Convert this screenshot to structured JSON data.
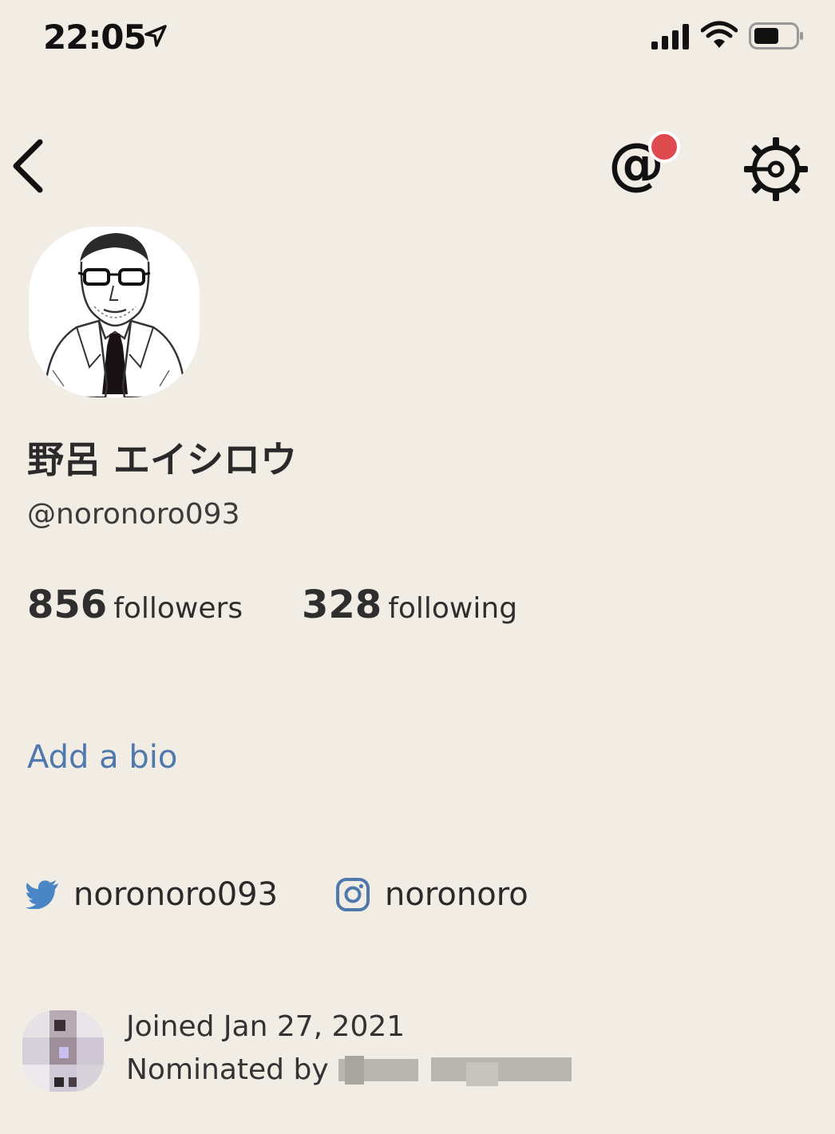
{
  "status_bar": {
    "time": "22:05"
  },
  "nav": {
    "mention_glyph": "@"
  },
  "profile": {
    "display_name": "野呂 エイシロウ",
    "handle": "@noronoro093",
    "followers_count": "856",
    "followers_label": "followers",
    "following_count": "328",
    "following_label": "following",
    "bio_link": "Add a bio"
  },
  "social": {
    "twitter_handle": "noronoro093",
    "instagram_handle": "noronoro"
  },
  "footer": {
    "joined": "Joined Jan 27, 2021",
    "nominated_by": "Nominated by"
  },
  "colors": {
    "background": "#f1ede5",
    "link": "#4f79ad",
    "notification": "#df4a4e",
    "twitter": "#4a86c5",
    "instagram": "#4f79ad"
  }
}
